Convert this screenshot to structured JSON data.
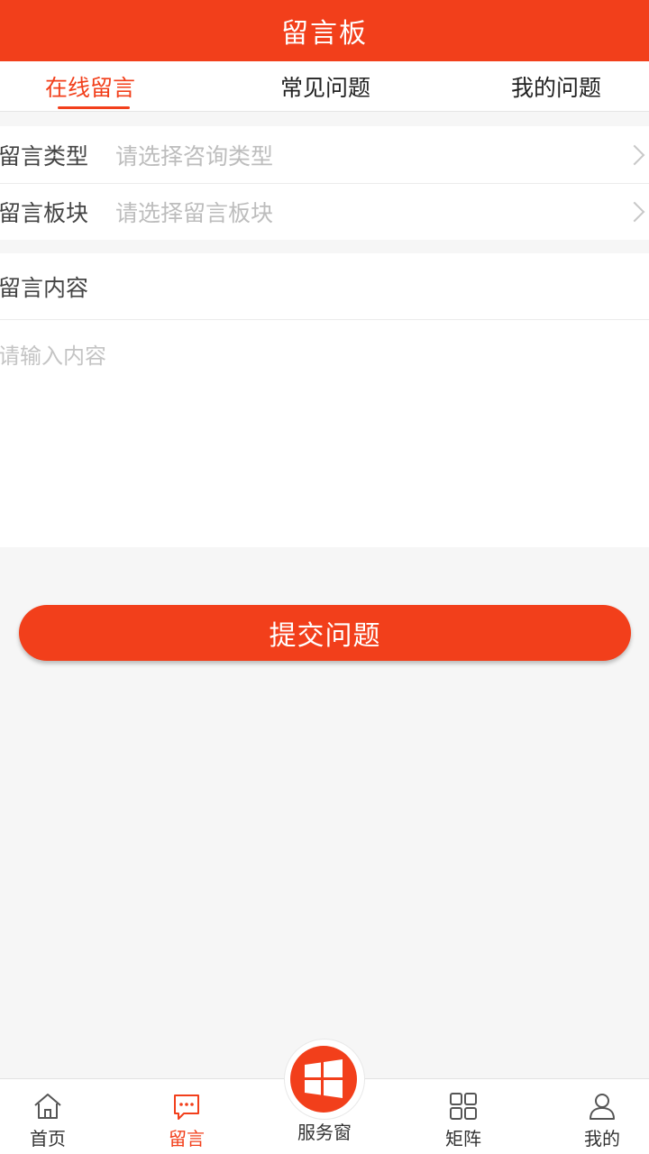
{
  "header": {
    "title": "留言板"
  },
  "tabs": [
    {
      "label": "在线留言",
      "active": true
    },
    {
      "label": "常见问题",
      "active": false
    },
    {
      "label": "我的问题",
      "active": false
    }
  ],
  "form": {
    "type_row": {
      "label": "留言类型",
      "placeholder": "请选择咨询类型"
    },
    "section_row": {
      "label": "留言板块",
      "placeholder": "请选择留言板块"
    },
    "content": {
      "label": "留言内容",
      "placeholder": "请输入内容"
    }
  },
  "submit_label": "提交问题",
  "bottom_nav": {
    "items": [
      {
        "label": "首页",
        "icon": "home-icon"
      },
      {
        "label": "留言",
        "icon": "message-icon",
        "active": true
      },
      {
        "label": "服务窗",
        "icon": "windows-icon"
      },
      {
        "label": "矩阵",
        "icon": "grid-icon"
      },
      {
        "label": "我的",
        "icon": "user-icon"
      }
    ]
  },
  "colors": {
    "accent": "#f23f1b",
    "background": "#f6f6f6"
  }
}
